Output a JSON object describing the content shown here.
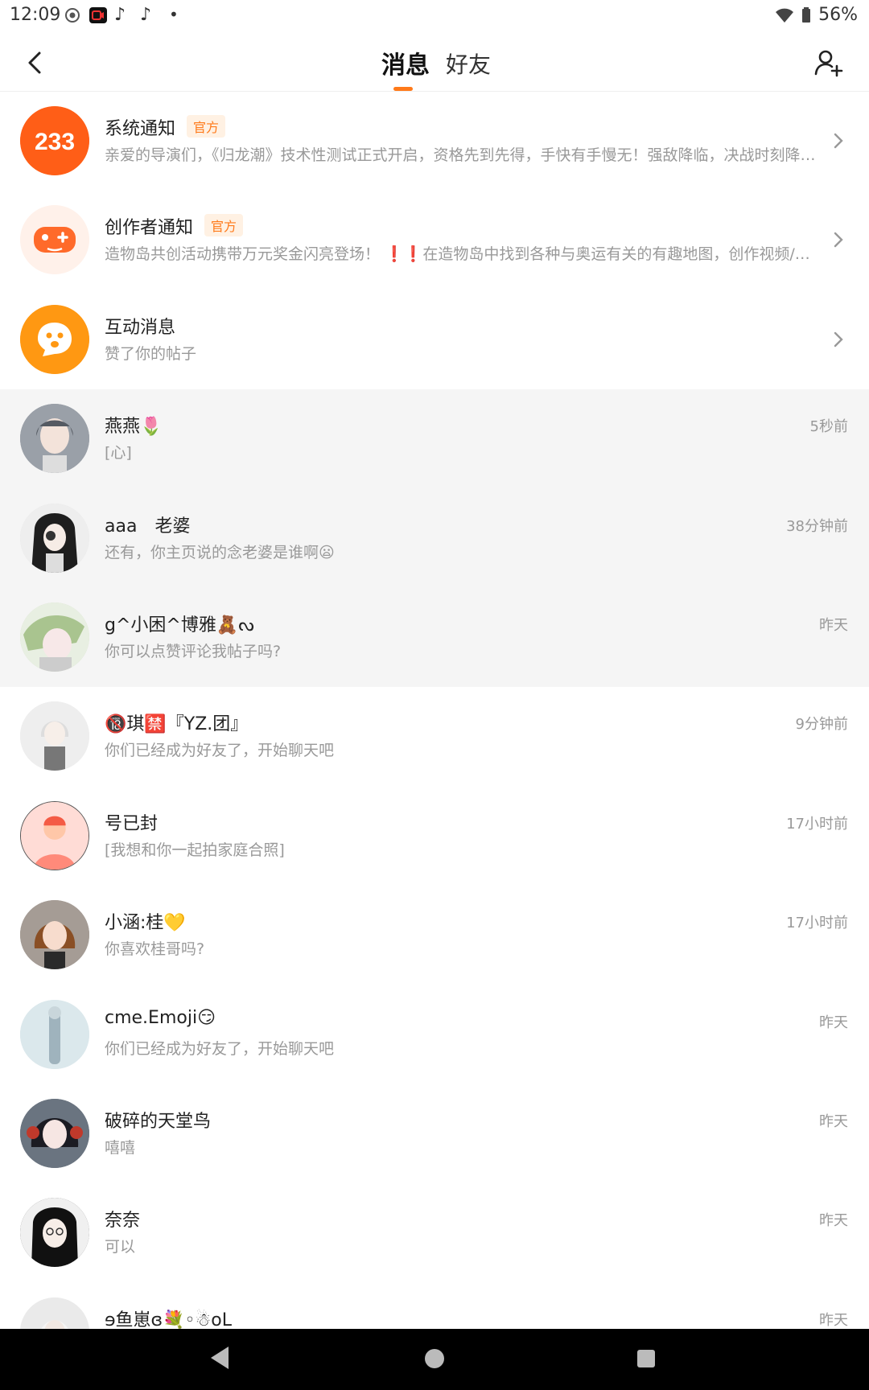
{
  "status_bar": {
    "time": "12:09",
    "battery": "56%"
  },
  "header": {
    "tabs": [
      {
        "label": "消息",
        "active": true
      },
      {
        "label": "好友",
        "active": false
      }
    ],
    "accent_color": "#ff7a1a"
  },
  "system_items": [
    {
      "name": "系统通知",
      "badge": "官方",
      "preview": "亲爱的导演们，《归龙潮》技术性测试正式开启，资格先到先得，手快有手慢无！强敌降临，决战时刻降…",
      "avatar_text": "233",
      "avatar_color": "#ff6a1a"
    },
    {
      "name": "创作者通知",
      "badge": "官方",
      "preview": "造物岛共创活动携带万元奖金闪亮登场！ ❗❗在造物岛中找到各种与奥运有关的有趣地图，创作视频/图…",
      "avatar_color": "#ff7a3a"
    },
    {
      "name": "互动消息",
      "badge": "",
      "preview": "赞了你的帖子",
      "avatar_color": "#ff9a1a"
    }
  ],
  "chats": [
    {
      "name": "燕燕🌷",
      "preview": "[心]",
      "time": "5秒前",
      "highlight": true,
      "avatar_color": "#8a8f99"
    },
    {
      "name": "aaa　老婆",
      "preview": "还有，你主页说的念老婆是谁啊😦",
      "time": "38分钟前",
      "highlight": true,
      "avatar_color": "#3a3a3a"
    },
    {
      "name": "g^小困^博雅🧸ᔓ",
      "preview": "你可以点赞评论我帖子吗?",
      "time": "昨天",
      "highlight": true,
      "avatar_color": "#c9d8b6"
    },
    {
      "name": "🔞琪🈲『YZ.团』",
      "preview": "你们已经成为好友了，开始聊天吧",
      "time": "9分钟前",
      "highlight": false,
      "avatar_color": "#e6e6e6"
    },
    {
      "name": "号已封",
      "preview": "[我想和你一起拍家庭合照]",
      "time": "17小时前",
      "highlight": false,
      "avatar_color": "#ffd6d0"
    },
    {
      "name": "小涵:桂💛",
      "preview": "你喜欢桂哥吗?",
      "time": "17小时前",
      "highlight": false,
      "avatar_color": "#9a8f88"
    },
    {
      "name": "cme.Emoji😏",
      "preview": "你们已经成为好友了，开始聊天吧",
      "time": "昨天",
      "highlight": false,
      "avatar_color": "#d8e6ea"
    },
    {
      "name": "破碎的天堂鸟",
      "preview": "嘻嘻",
      "time": "昨天",
      "highlight": false,
      "avatar_color": "#5a6470"
    },
    {
      "name": "奈奈",
      "preview": "可以",
      "time": "昨天",
      "highlight": false,
      "avatar_color": "#3a3a3a"
    },
    {
      "name": "ɘ鱼崽ɞ💐◦☃oL",
      "preview": "",
      "time": "昨天",
      "highlight": false,
      "avatar_color": "#e8e8e8"
    }
  ]
}
